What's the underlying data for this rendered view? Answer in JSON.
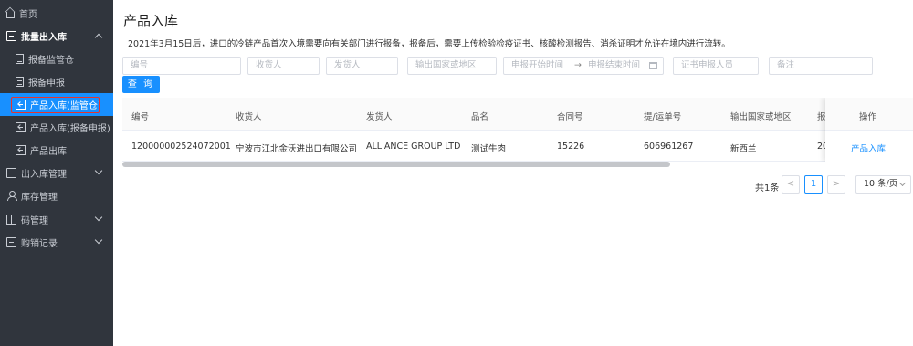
{
  "sidebar": {
    "items": [
      {
        "label": "首页",
        "icon": "home-icon"
      },
      {
        "label": "批量出入库",
        "icon": "box-icon",
        "expanded": true
      },
      {
        "label": "报备监管仓",
        "icon": "document-icon"
      },
      {
        "label": "报备申报",
        "icon": "document-icon"
      },
      {
        "label": "产品入库(监管仓)",
        "icon": "import-icon",
        "active": true
      },
      {
        "label": "产品入库(报备申报)",
        "icon": "import-icon"
      },
      {
        "label": "产品出库",
        "icon": "import-icon"
      },
      {
        "label": "出入库管理",
        "icon": "box-icon"
      },
      {
        "label": "库存管理",
        "icon": "people-icon"
      },
      {
        "label": "码管理",
        "icon": "grid-icon"
      },
      {
        "label": "购销记录",
        "icon": "box-icon"
      }
    ],
    "active_color": "#1890ff",
    "bg_color": "#30353d"
  },
  "page": {
    "title": "产品入库",
    "notice": "2021年3月15日后，进口的冷链产品首次入境需要向有关部门进行报备，报备后，需要上传检验检疫证书、核酸检测报告、消杀证明才允许在境内进行流转。"
  },
  "filters": {
    "number": "编号",
    "consignee": "收货人",
    "shipper": "发货人",
    "origin": "输出国家或地区",
    "date_start": "申报开始时间",
    "date_arrow": "→",
    "date_end": "申报结束时间",
    "declarant": "证书申报人员",
    "remark": "备注",
    "query_button": "查 询"
  },
  "table": {
    "headers": [
      "编号",
      "收货人",
      "发货人",
      "品名",
      "合同号",
      "提/运单号",
      "输出国家或地区",
      "报",
      "操作"
    ],
    "rows": [
      [
        "120000002524072001",
        "宁波市江北金沃进出口有限公司",
        "ALLIANCE GROUP LTD",
        "测试牛肉",
        "15226",
        "606961267",
        "新西兰",
        "20",
        "产品入库"
      ]
    ]
  },
  "pagination": {
    "total": "共1条",
    "prev": "<",
    "current": "1",
    "next": ">",
    "page_size": "10 条/页"
  }
}
